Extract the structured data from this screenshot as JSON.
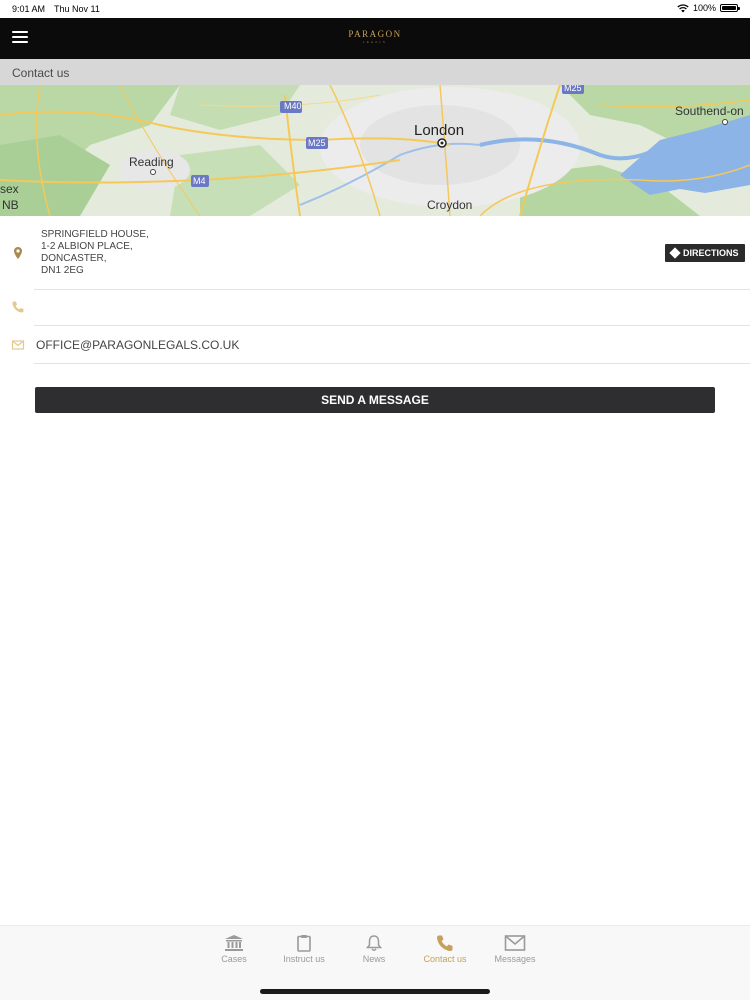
{
  "status_bar": {
    "time": "9:01 AM",
    "date": "Thu Nov 11",
    "battery": "100%"
  },
  "header": {
    "logo_text": "PARAGON",
    "logo_subtext": "LEGALS"
  },
  "page": {
    "title": "Contact us"
  },
  "map": {
    "labels": {
      "london": "London",
      "reading": "Reading",
      "croydon": "Croydon",
      "southend": "Southend-on",
      "sex": "sex",
      "nb": "NB",
      "m40": "M40",
      "m25_left": "M25",
      "m25_top": "M25",
      "m4": "M4"
    }
  },
  "contact": {
    "address_lines": [
      "SPRINGFIELD HOUSE,",
      "1-2 ALBION PLACE,",
      "DONCASTER,",
      "DN1 2EG"
    ],
    "directions_label": "DIRECTIONS",
    "phone": "",
    "email": "OFFICE@PARAGONLEGALS.CO.UK",
    "send_label": "SEND A MESSAGE"
  },
  "colors": {
    "accent": "#c6a15b",
    "nav_bg": "#0b0b0b",
    "button_bg": "#2e2e30"
  },
  "tabs": [
    {
      "label": "Cases",
      "icon": "bank-icon",
      "active": false
    },
    {
      "label": "Instruct us",
      "icon": "clipboard-icon",
      "active": false
    },
    {
      "label": "News",
      "icon": "bell-icon",
      "active": false
    },
    {
      "label": "Contact us",
      "icon": "phone-icon",
      "active": true
    },
    {
      "label": "Messages",
      "icon": "envelope-icon",
      "active": false
    }
  ]
}
